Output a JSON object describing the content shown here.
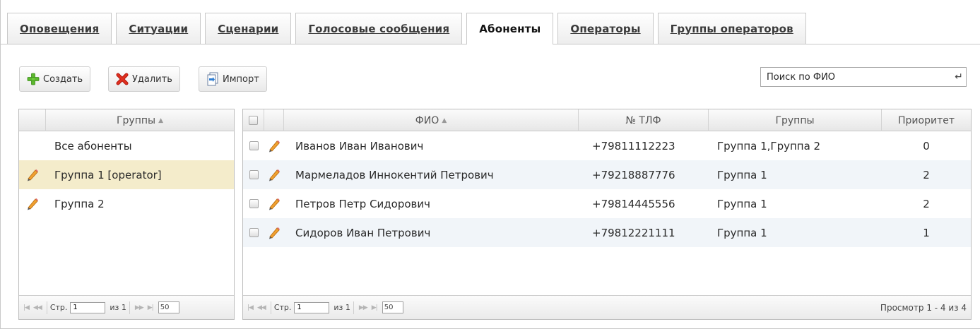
{
  "tabs": [
    {
      "label": "Оповещения",
      "active": false
    },
    {
      "label": "Ситуации",
      "active": false
    },
    {
      "label": "Сценарии",
      "active": false
    },
    {
      "label": "Голосовые сообщения",
      "active": false
    },
    {
      "label": "Абоненты",
      "active": true
    },
    {
      "label": "Операторы",
      "active": false
    },
    {
      "label": "Группы операторов",
      "active": false
    }
  ],
  "toolbar": {
    "create_label": "Создать",
    "delete_label": "Удалить",
    "import_label": "Импорт"
  },
  "search": {
    "placeholder": "Поиск по ФИО"
  },
  "groups_grid": {
    "header": "Группы",
    "rows": [
      {
        "name": "Все абоненты",
        "editable": false,
        "selected": false
      },
      {
        "name": "Группа 1 [operator]",
        "editable": true,
        "selected": true
      },
      {
        "name": "Группа 2",
        "editable": true,
        "selected": false
      }
    ],
    "pager": {
      "page_label": "Стр.",
      "page": "1",
      "of_label": "из 1",
      "rows_per_page": "50"
    }
  },
  "subscribers_grid": {
    "columns": {
      "name": "ФИО",
      "phone": "№ ТЛФ",
      "groups": "Группы",
      "priority": "Приоритет"
    },
    "rows": [
      {
        "name": "Иванов Иван Иванович",
        "phone": "+79811112223",
        "groups": "Группа 1,Группа 2",
        "priority": "0"
      },
      {
        "name": "Мармеладов Иннокентий Петрович",
        "phone": "+79218887776",
        "groups": "Группа 1",
        "priority": "2"
      },
      {
        "name": "Петров Петр Сидорович",
        "phone": "+79814445556",
        "groups": "Группа 1",
        "priority": "2"
      },
      {
        "name": "Сидоров Иван Петрович",
        "phone": "+79812221111",
        "groups": "Группа 1",
        "priority": "1"
      }
    ],
    "pager": {
      "page_label": "Стр.",
      "page": "1",
      "of_label": "из 1",
      "rows_per_page": "50",
      "view_info": "Просмотр 1 - 4 из 4"
    }
  },
  "icons": {
    "create": "plus-icon",
    "delete": "red-x-icon",
    "import": "import-icon",
    "edit": "pencil-icon",
    "search_submit": "enter-icon"
  }
}
